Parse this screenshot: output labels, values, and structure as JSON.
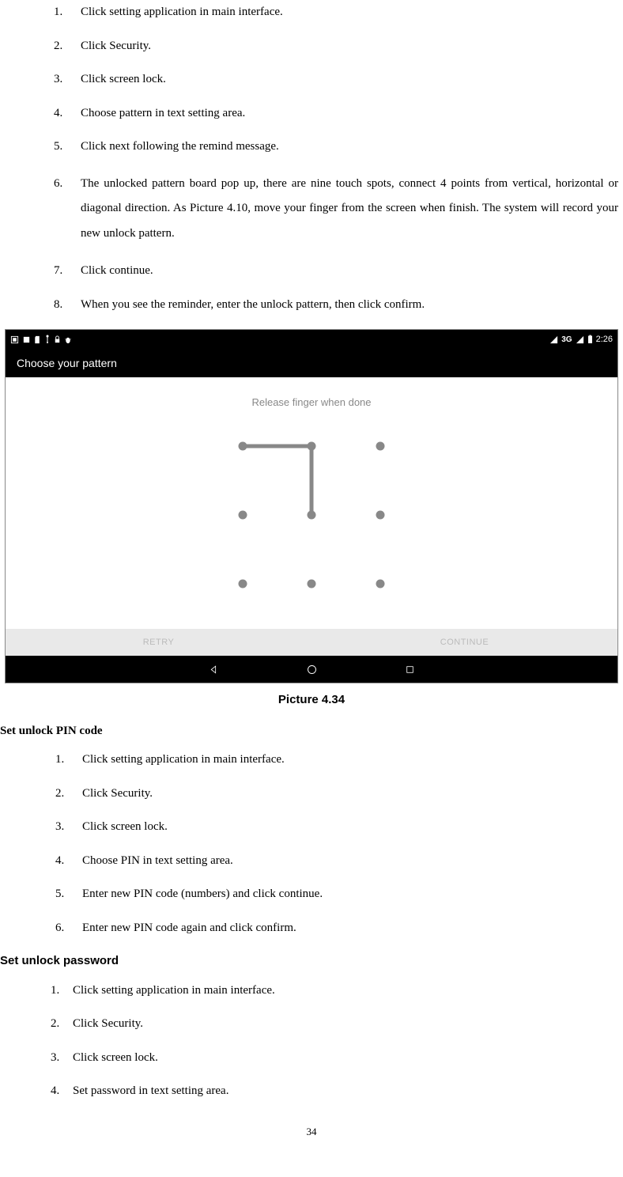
{
  "list1": {
    "items": [
      {
        "num": "1.",
        "text": "Click setting application in main interface."
      },
      {
        "num": "2.",
        "text": "Click Security."
      },
      {
        "num": "3.",
        "text": "Click screen lock."
      },
      {
        "num": "4.",
        "text": "Choose pattern in text setting area."
      },
      {
        "num": "5.",
        "text": "Click next following the remind message."
      },
      {
        "num": "6.",
        "text": "The unlocked pattern board pop up, there are nine touch spots, connect 4 points from vertical, horizontal or diagonal direction. As Picture 4.10, move your finger from the screen when finish. The system will record your new unlock pattern."
      },
      {
        "num": "7.",
        "text": "Click continue."
      },
      {
        "num": "8.",
        "text": "When you see the reminder, enter the unlock pattern, then click confirm."
      }
    ]
  },
  "screenshot": {
    "status_time": "2:26",
    "status_net": "3G",
    "title": "Choose your pattern",
    "instruction": "Release finger when done",
    "retry": "RETRY",
    "continue": "CONTINUE"
  },
  "caption": "Picture 4.34",
  "heading_pin": "Set unlock PIN code",
  "list_pin": {
    "items": [
      {
        "num": "1.",
        "text": "Click setting application in main interface."
      },
      {
        "num": "2.",
        "text": "Click Security."
      },
      {
        "num": "3.",
        "text": "Click screen lock."
      },
      {
        "num": "4.",
        "text": "Choose PIN in text setting area."
      },
      {
        "num": "5.",
        "text": "Enter new PIN code (numbers) and click continue."
      },
      {
        "num": "6.",
        "text": "Enter new PIN code again and click confirm."
      }
    ]
  },
  "heading_pw": "Set unlock password",
  "list_pw": {
    "items": [
      {
        "num": "1.",
        "text": "Click setting application in main interface."
      },
      {
        "num": "2.",
        "text": "Click Security."
      },
      {
        "num": "3.",
        "text": "Click screen lock."
      },
      {
        "num": "4.",
        "text": "Set password in text setting area."
      }
    ]
  },
  "page_number": "34"
}
